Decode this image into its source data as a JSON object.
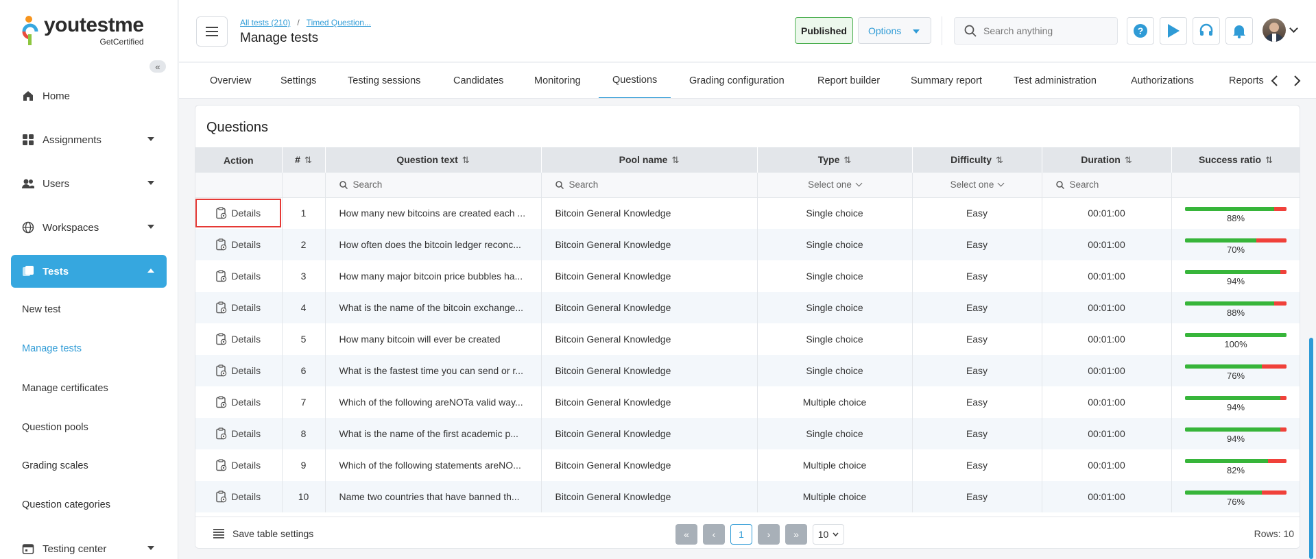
{
  "brand": {
    "name": "youtestme",
    "tagline": "GetCertified",
    "accent": "#36a7df"
  },
  "sidebar": {
    "items": [
      {
        "label": "Home",
        "icon": "home-icon"
      },
      {
        "label": "Assignments",
        "icon": "assignments-icon"
      },
      {
        "label": "Users",
        "icon": "users-icon"
      },
      {
        "label": "Workspaces",
        "icon": "globe-icon"
      },
      {
        "label": "Tests",
        "icon": "tests-icon"
      },
      {
        "label": "Testing center",
        "icon": "calendar-icon"
      }
    ],
    "subitems": [
      "New test",
      "Manage tests",
      "Manage certificates",
      "Question pools",
      "Grading scales",
      "Question categories"
    ]
  },
  "header": {
    "breadcrumb": [
      "All tests (210)",
      "Timed Question..."
    ],
    "title": "Manage tests",
    "published_label": "Published",
    "options_label": "Options",
    "search_placeholder": "Search anything"
  },
  "tabs": [
    "Overview",
    "Settings",
    "Testing sessions",
    "Candidates",
    "Monitoring",
    "Questions",
    "Grading configuration",
    "Report builder",
    "Summary report",
    "Test administration",
    "Authorizations",
    "Reports"
  ],
  "active_tab": "Questions",
  "card": {
    "title": "Questions",
    "columns": [
      "Action",
      "#",
      "Question text",
      "Pool name",
      "Type",
      "Difficulty",
      "Duration",
      "Success ratio"
    ],
    "filters": {
      "search_placeholder": "Search",
      "select_placeholder": "Select one"
    },
    "rows": [
      {
        "action": "Details",
        "num": "1",
        "text": "How many new bitcoins are created each ...",
        "pool": "Bitcoin General Knowledge",
        "type": "Single choice",
        "difficulty": "Easy",
        "duration": "00:01:00",
        "ratio": 88,
        "ratio_label": "88%"
      },
      {
        "action": "Details",
        "num": "2",
        "text": "How often does the bitcoin ledger reconc...",
        "pool": "Bitcoin General Knowledge",
        "type": "Single choice",
        "difficulty": "Easy",
        "duration": "00:01:00",
        "ratio": 70,
        "ratio_label": "70%"
      },
      {
        "action": "Details",
        "num": "3",
        "text": "How many major bitcoin price bubbles ha...",
        "pool": "Bitcoin General Knowledge",
        "type": "Single choice",
        "difficulty": "Easy",
        "duration": "00:01:00",
        "ratio": 94,
        "ratio_label": "94%"
      },
      {
        "action": "Details",
        "num": "4",
        "text": "What is the name of the bitcoin exchange...",
        "pool": "Bitcoin General Knowledge",
        "type": "Single choice",
        "difficulty": "Easy",
        "duration": "00:01:00",
        "ratio": 88,
        "ratio_label": "88%"
      },
      {
        "action": "Details",
        "num": "5",
        "text": "How many bitcoin will ever be created",
        "pool": "Bitcoin General Knowledge",
        "type": "Single choice",
        "difficulty": "Easy",
        "duration": "00:01:00",
        "ratio": 100,
        "ratio_label": "100%"
      },
      {
        "action": "Details",
        "num": "6",
        "text": "What is the fastest time you can send or r...",
        "pool": "Bitcoin General Knowledge",
        "type": "Single choice",
        "difficulty": "Easy",
        "duration": "00:01:00",
        "ratio": 76,
        "ratio_label": "76%"
      },
      {
        "action": "Details",
        "num": "7",
        "text": "Which of the following areNOTa valid way...",
        "pool": "Bitcoin General Knowledge",
        "type": "Multiple choice",
        "difficulty": "Easy",
        "duration": "00:01:00",
        "ratio": 94,
        "ratio_label": "94%"
      },
      {
        "action": "Details",
        "num": "8",
        "text": "What is the name of the first academic p...",
        "pool": "Bitcoin General Knowledge",
        "type": "Single choice",
        "difficulty": "Easy",
        "duration": "00:01:00",
        "ratio": 94,
        "ratio_label": "94%"
      },
      {
        "action": "Details",
        "num": "9",
        "text": "Which of the following statements areNO...",
        "pool": "Bitcoin General Knowledge",
        "type": "Multiple choice",
        "difficulty": "Easy",
        "duration": "00:01:00",
        "ratio": 82,
        "ratio_label": "82%"
      },
      {
        "action": "Details",
        "num": "10",
        "text": "Name two countries that have banned th...",
        "pool": "Bitcoin General Knowledge",
        "type": "Multiple choice",
        "difficulty": "Easy",
        "duration": "00:01:00",
        "ratio": 76,
        "ratio_label": "76%"
      }
    ],
    "footer": {
      "save_label": "Save table settings",
      "current_page": "1",
      "page_size": "10",
      "rows_label": "Rows: 10"
    }
  }
}
